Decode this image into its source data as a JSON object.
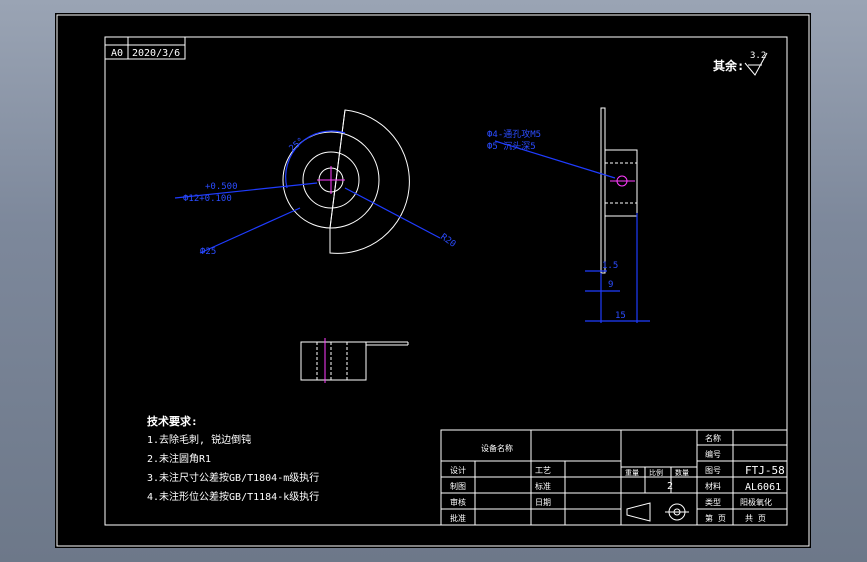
{
  "revision": {
    "code": "A0",
    "date": "2020/3/6"
  },
  "roughness": {
    "label": "其余:",
    "value": "3.2"
  },
  "top_view": {
    "tol_plus": "+0.500",
    "tol_main": "Ф12+0.100",
    "hole_r": "Ф25",
    "angle": "25°",
    "radius": "R20"
  },
  "side_view": {
    "note1": "Ф4-通孔攻M5",
    "note2": "Ф5 沉头深5",
    "dim_15": "1.5",
    "dim_9": "9",
    "dim_15b": "15"
  },
  "tech_notes": {
    "title": "技术要求:",
    "items": [
      "1.去除毛刺, 锐边倒钝",
      "2.未注圆角R1",
      "3.未注尺寸公差按GB/T1804-m级执行",
      "4.未注形位公差按GB/T1184-k级执行"
    ]
  },
  "title_block": {
    "equipment_label": "设备名称",
    "name_label": "名称",
    "code_label": "编号",
    "drawing_no_label": "图号",
    "drawing_no": "FTJ-58",
    "material_label": "材料",
    "material": "AL6061",
    "qty": "2",
    "design": "设计",
    "draw": "制图",
    "check": "审核",
    "approve": "批准",
    "date_label": "日期",
    "std_label": "标准",
    "process_label": "工艺",
    "weight_label": "重量",
    "scale_label": "比例",
    "qty_label": "数量",
    "type_label": "类型",
    "treatment": "阳极氧化",
    "sheet_label": "第 页",
    "total_label": "共 页"
  }
}
